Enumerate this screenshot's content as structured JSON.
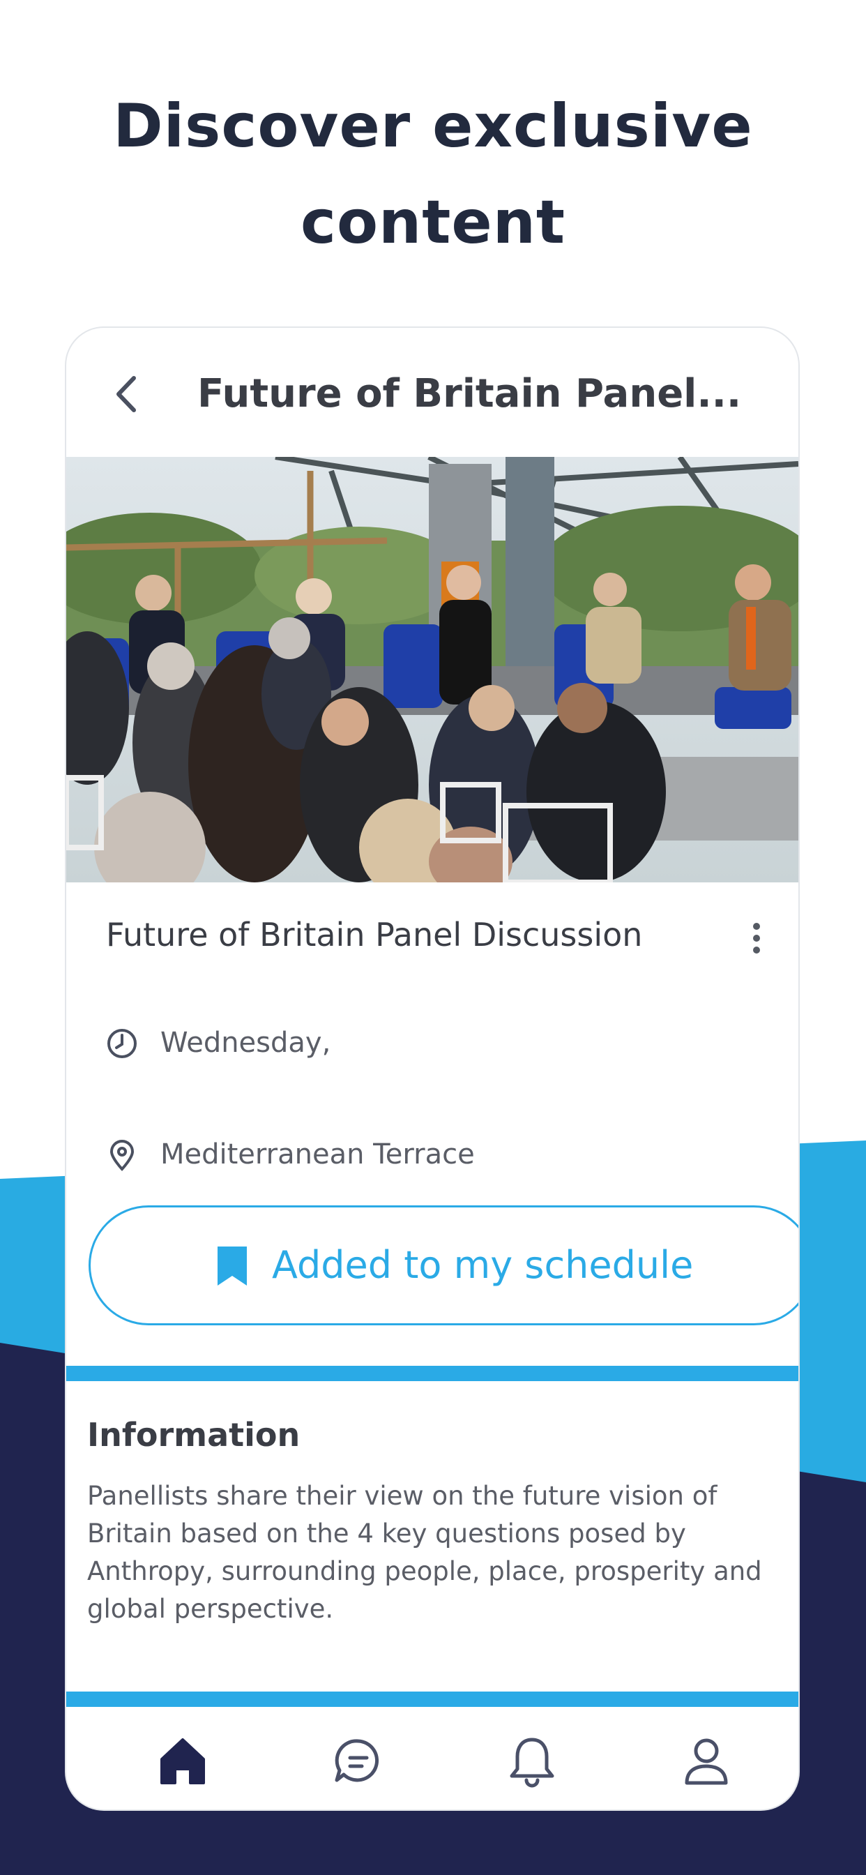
{
  "headline": {
    "line1": "Discover exclusive",
    "line2": "content"
  },
  "colors": {
    "navy": "#20244f",
    "sky": "#29abe2",
    "accent": "#2aaae6",
    "title_text": "#222a3e"
  },
  "screen": {
    "nav": {
      "back_icon": "chevron-left-icon",
      "title": "Future of Britain Panel..."
    },
    "hero_image": {
      "subject": "panel discussion photo"
    },
    "event": {
      "title": "Future of Britain Panel Discussion",
      "more_icon": "more-vertical-icon",
      "date_icon": "clock-icon",
      "date": "Wednesday,",
      "location_icon": "map-pin-icon",
      "location": "Mediterranean Terrace"
    },
    "schedule_button": {
      "icon": "bookmark-icon",
      "label": "Added to my schedule"
    },
    "information": {
      "heading": "Information",
      "body": "Panellists share their view on the future vision of Britain based on the 4 key questions posed by Anthropy, surrounding people, place, prosperity and global perspective."
    },
    "tabbar": {
      "active_tab": "home",
      "tabs": [
        "home-icon",
        "chat-icon",
        "bell-icon",
        "user-icon"
      ]
    }
  }
}
